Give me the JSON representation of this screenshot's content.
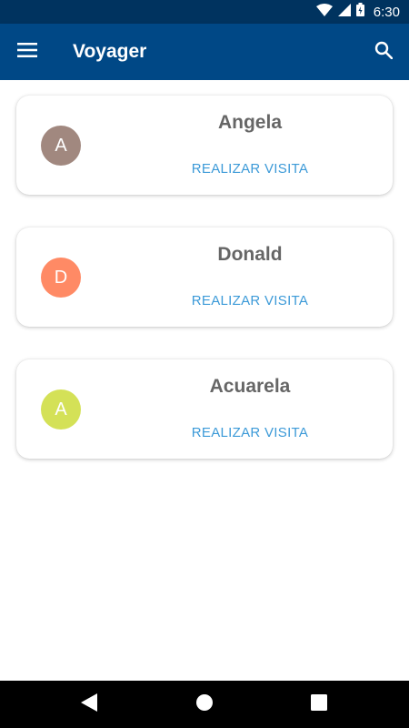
{
  "status_bar": {
    "time": "6:30",
    "icons": [
      "wifi-icon",
      "signal-icon",
      "battery-icon"
    ]
  },
  "app_bar": {
    "title": "Voyager",
    "menu_icon": "menu-icon",
    "search_icon": "search-icon",
    "color": "#004886"
  },
  "cards": [
    {
      "initial": "A",
      "name": "Angela",
      "action": "REALIZAR VISITA",
      "avatar_color": "#a1887f"
    },
    {
      "initial": "D",
      "name": "Donald",
      "action": "REALIZAR VISITA",
      "avatar_color": "#ff8a65"
    },
    {
      "initial": "A",
      "name": "Acuarela",
      "action": "REALIZAR VISITA",
      "avatar_color": "#d4e157"
    }
  ],
  "nav_bar": {
    "icons": [
      "back-icon",
      "home-icon",
      "recents-icon"
    ]
  },
  "colors": {
    "status_bar": "#00335f",
    "action_text": "#3c9ad8",
    "name_text": "#666666"
  }
}
